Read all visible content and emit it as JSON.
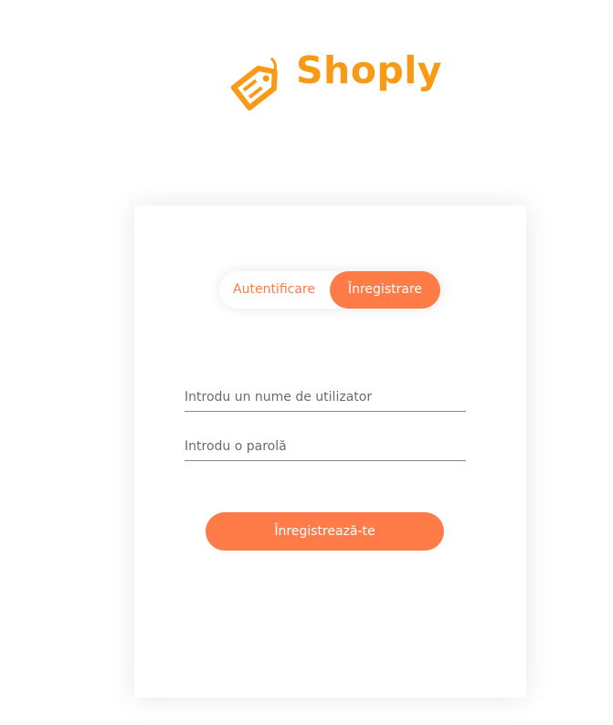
{
  "brand": {
    "name": "Shoply",
    "color": "#f89a16",
    "logo_icon": "price-tag-icon"
  },
  "auth": {
    "tabs": {
      "login_label": "Autentificare",
      "register_label": "Înregistrare",
      "active": "register"
    },
    "username_placeholder": "Introdu un nume de utilizator",
    "password_placeholder": "Introdu o parolă",
    "submit_label": "Înregistrează-te"
  },
  "colors": {
    "accent": "#ff7b47",
    "brand": "#f89a16"
  }
}
